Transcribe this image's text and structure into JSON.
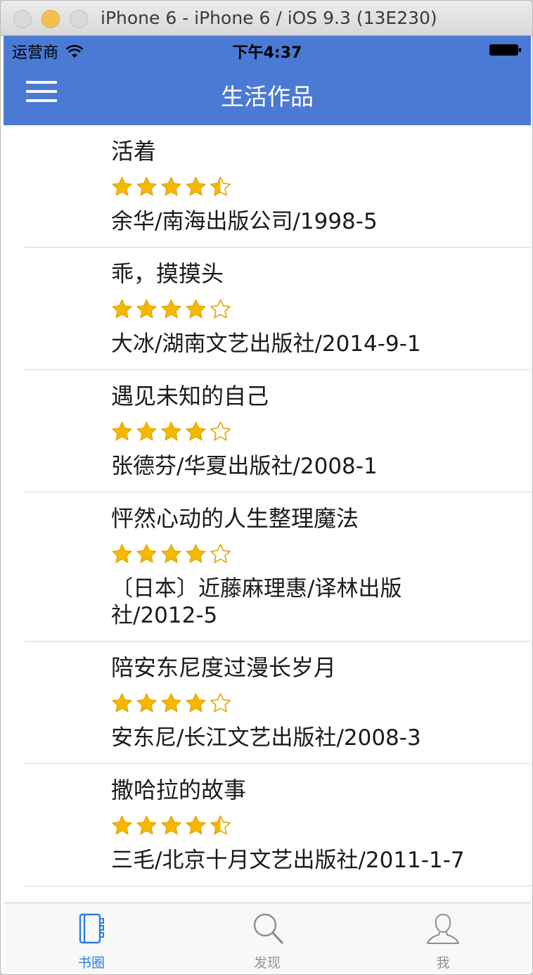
{
  "window": {
    "title": "iPhone 6 - iPhone 6 / iOS 9.3 (13E230)"
  },
  "status_bar": {
    "carrier": "运营商",
    "time": "下午4:37"
  },
  "navbar": {
    "title": "生活作品"
  },
  "books": [
    {
      "title": "活着",
      "rating": 4.5,
      "meta": "余华/南海出版公司/1998-5"
    },
    {
      "title": "乖，摸摸头",
      "rating": 4,
      "meta": "大冰/湖南文艺出版社/2014-9-1"
    },
    {
      "title": "遇见未知的自己",
      "rating": 4,
      "meta": "张德芬/华夏出版社/2008-1"
    },
    {
      "title": "怦然心动的人生整理魔法",
      "rating": 4,
      "meta": "〔日本〕近藤麻理惠/译林出版社/2012-5"
    },
    {
      "title": "陪安东尼度过漫长岁月",
      "rating": 4,
      "meta": "安东尼/长江文艺出版社/2008-3"
    },
    {
      "title": "撒哈拉的故事",
      "rating": 4.5,
      "meta": "三毛/北京十月文艺出版社/2011-1-7"
    }
  ],
  "tabs": [
    {
      "label": "书圈",
      "icon": "book-icon",
      "active": true
    },
    {
      "label": "发现",
      "icon": "magnifier-icon",
      "active": false
    },
    {
      "label": "我",
      "icon": "person-icon",
      "active": false
    }
  ],
  "colors": {
    "navbar": "#4a7ad4",
    "star": "#f5b800",
    "tab_active": "#2a7fdc",
    "tab_inactive": "#929292"
  }
}
